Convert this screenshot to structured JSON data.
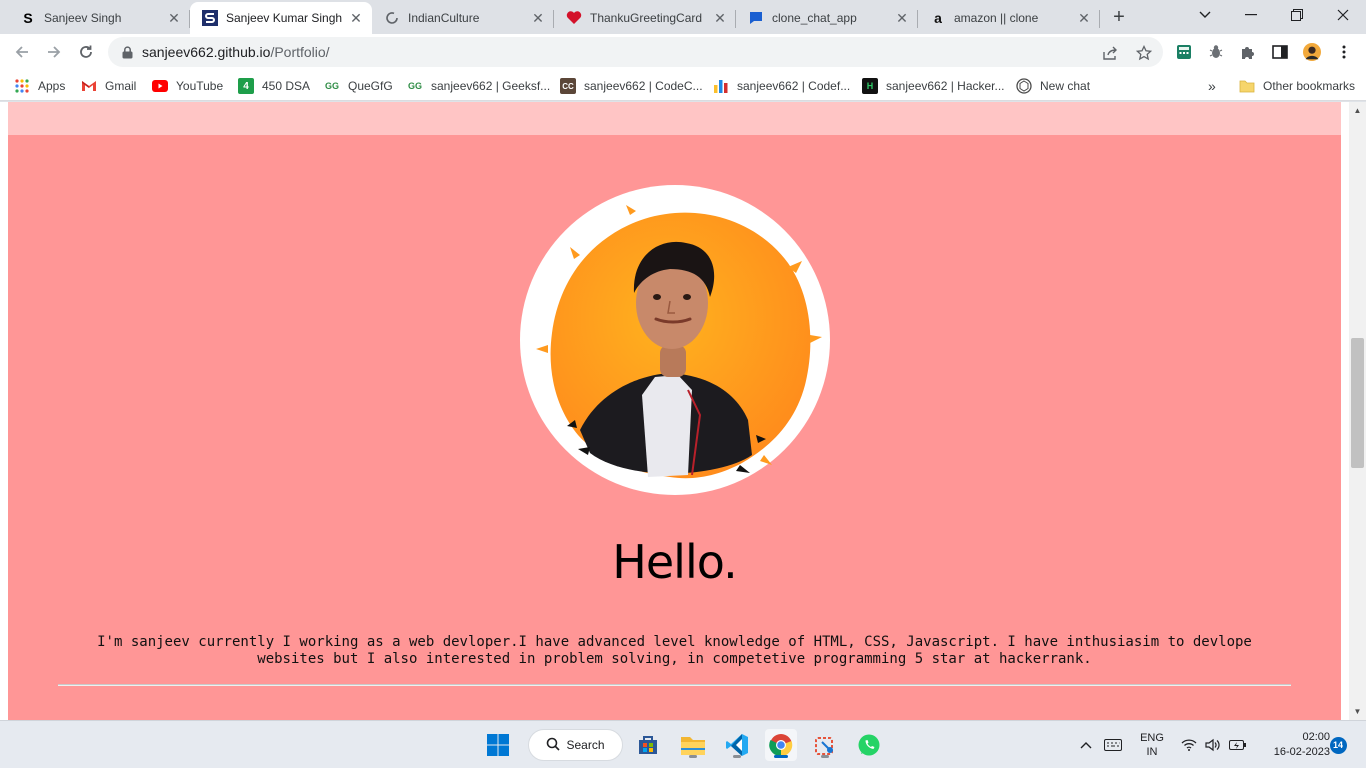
{
  "browser": {
    "tabs": [
      {
        "title": "Sanjeev Singh",
        "favicon": "s-letter-icon",
        "active": false
      },
      {
        "title": "Sanjeev Kumar Singh",
        "favicon": "s-logo-icon",
        "active": true
      },
      {
        "title": "IndianCulture",
        "favicon": "loading-icon",
        "active": false
      },
      {
        "title": "ThankuGreetingCard",
        "favicon": "heart-icon",
        "active": false
      },
      {
        "title": "clone_chat_app",
        "favicon": "chat-icon",
        "active": false
      },
      {
        "title": "amazon || clone",
        "favicon": "amazon-icon",
        "active": false
      }
    ],
    "tab_close_glyph": "✕",
    "new_tab_glyph": "+",
    "url_host": "sanjeev662.github.io",
    "url_path": "/Portfolio/",
    "bookmarks": [
      {
        "label": "Apps",
        "icon": "apps-grid-icon"
      },
      {
        "label": "Gmail",
        "icon": "gmail-icon"
      },
      {
        "label": "YouTube",
        "icon": "youtube-icon"
      },
      {
        "label": "450 DSA",
        "icon": "dsa-icon",
        "badge": "4"
      },
      {
        "label": "QueGfG",
        "icon": "gfg-icon",
        "badge": "GG"
      },
      {
        "label": "sanjeev662 | Geeksf...",
        "icon": "gfg-icon",
        "badge": "GG"
      },
      {
        "label": "sanjeev662 | CodeC...",
        "icon": "codechef-icon",
        "badge": "CC"
      },
      {
        "label": "sanjeev662 | Codef...",
        "icon": "codeforces-icon"
      },
      {
        "label": "sanjeev662 | Hacker...",
        "icon": "hackerrank-icon",
        "badge": "H"
      },
      {
        "label": "New chat",
        "icon": "chatgpt-icon"
      }
    ],
    "bookmarks_overflow": "»",
    "other_bookmarks": "Other bookmarks"
  },
  "page": {
    "greeting": "Hello.",
    "about": "I'm sanjeev currently I working as a web devloper.I have advanced level knowledge of HTML, CSS, Javascript. I have inthusiasim to devlope websites but I also interested in problem solving, in competetive programming 5 star at hackerrank.",
    "colors": {
      "background": "#ff9696",
      "top_band": "#ffc5c5",
      "avatar_ring": "#ffffff",
      "avatar_splash": "#ffa51f"
    }
  },
  "taskbar": {
    "search_label": "Search",
    "language": "ENG",
    "region": "IN",
    "time": "02:00",
    "date": "16-02-2023",
    "notification_count": "14",
    "apps": [
      "start-icon",
      "search",
      "store-icon",
      "file-explorer-icon",
      "vscode-icon",
      "chrome-icon",
      "snipping-tool-icon",
      "whatsapp-icon"
    ]
  }
}
